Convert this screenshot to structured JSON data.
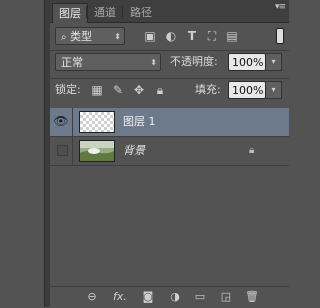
{
  "tabs": [
    {
      "label": "图层",
      "active": true
    },
    {
      "label": "通道",
      "active": false
    },
    {
      "label": "路径",
      "active": false
    }
  ],
  "filter": {
    "kind_label": "类型"
  },
  "blend": {
    "mode": "正常",
    "opacity_label": "不透明度:",
    "opacity_value": "100%"
  },
  "lock": {
    "label": "锁定:",
    "fill_label": "填充:",
    "fill_value": "100%"
  },
  "layers": [
    {
      "name": "图层 1",
      "visible": true,
      "selected": true,
      "thumb": "transparent"
    },
    {
      "name": "背景",
      "visible": false,
      "selected": false,
      "thumb": "photo",
      "locked": true
    }
  ],
  "icons": {
    "filter_search": "search-icon",
    "filter_types": [
      "image-filter-icon",
      "adjustment-filter-icon",
      "type-filter-icon",
      "shape-filter-icon",
      "smart-object-filter-icon"
    ],
    "lock_types": [
      "lock-transparent-pixels-icon",
      "lock-image-pixels-icon",
      "lock-position-icon",
      "lock-all-icon"
    ],
    "bottom": [
      "link-layers-icon",
      "fx-icon",
      "add-mask-icon",
      "adjustment-layer-icon",
      "new-group-icon",
      "new-layer-icon",
      "delete-layer-icon"
    ]
  }
}
